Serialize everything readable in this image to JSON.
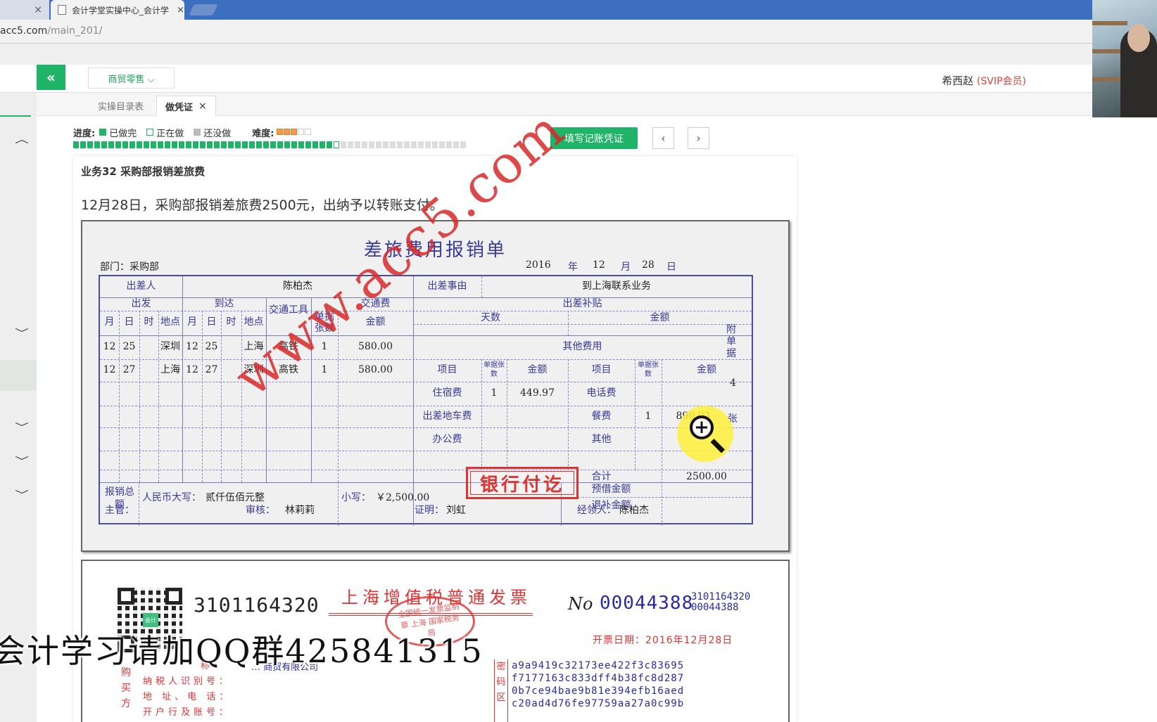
{
  "browser": {
    "tab_left_close": "×",
    "tab_title": "会计学堂实操中心_会计学",
    "tab_close": "×",
    "url_main": "acc5.com",
    "url_path": "/main_201/"
  },
  "header": {
    "collapse_icon": "«",
    "dept_select": "商贸零售 ⌵",
    "user_name": "希西赵",
    "user_level": "(SVIP会员)"
  },
  "tabs": [
    {
      "label": "实操目录表"
    },
    {
      "label": "做凭证",
      "close": "×"
    }
  ],
  "progress": {
    "label": "进度:",
    "done_label": "已做完",
    "doing_label": "正在做",
    "todo_label": "还没做",
    "difficulty_label": "难度:",
    "difficulty_stars": 3,
    "difficulty_max": 5,
    "total_items": 56,
    "completed_items": 37,
    "current_item": 38
  },
  "actions": {
    "fill_voucher": "填写记账凭证",
    "prev": "‹",
    "next": "›"
  },
  "task": {
    "title": "业务32 采购部报销差旅费",
    "description": "12月28日，采购部报销差旅费2500元，出纳予以转账支付。"
  },
  "form": {
    "title": "差旅费用报销单",
    "department": "部门：采购部",
    "year": "2016",
    "year_unit": "年",
    "month": "12",
    "month_unit": "月",
    "day": "28",
    "day_unit": "日",
    "traveler_label": "出差人",
    "traveler": "陈柏杰",
    "reason_label": "出差事由",
    "reason": "到上海联系业务",
    "depart_label": "出发",
    "arrive_label": "到达",
    "transport_tool_label": "交通工具",
    "receipts_label": "单据张数",
    "transport_fee_label": "交通费",
    "allowance_label": "出差补贴",
    "days_label": "天数",
    "amount_label": "金额",
    "month_h": "月",
    "day_h": "日",
    "hour_h": "时",
    "place_h": "地点",
    "other_fees_label": "其他费用",
    "item_label": "项目",
    "trips": [
      {
        "m1": "12",
        "d1": "25",
        "p1": "深圳",
        "m2": "12",
        "d2": "25",
        "p2": "上海",
        "tool": "高铁",
        "n": "1",
        "amt": "580.00"
      },
      {
        "m1": "12",
        "d1": "27",
        "p1": "上海",
        "m2": "12",
        "d2": "27",
        "p2": "深圳",
        "tool": "高铁",
        "n": "1",
        "amt": "580.00"
      }
    ],
    "other_left": [
      {
        "item": "住宿费",
        "n": "1",
        "amt": "449.97"
      },
      {
        "item": "出差地车费",
        "n": "",
        "amt": ""
      },
      {
        "item": "办公费",
        "n": "",
        "amt": ""
      }
    ],
    "other_right": [
      {
        "item": "电话费",
        "n": "",
        "amt": ""
      },
      {
        "item": "餐费",
        "n": "1",
        "amt": "890.03"
      },
      {
        "item": "其他",
        "n": "",
        "amt": ""
      }
    ],
    "total_label": "合计",
    "total": "2500.00",
    "sum_label": "报销总额",
    "rmb_upper_label": "人民币大写：",
    "rmb_upper": "贰仟伍佰元整",
    "small_label": "小写：",
    "small": "￥2,500.00",
    "advance_label": "预借金额",
    "refund_label": "退补金额",
    "attach_label": "附单据",
    "attach_count": "4",
    "attach_unit": "张",
    "supervisor_label": "主管：",
    "reviewer_label": "审核：",
    "reviewer": "林莉莉",
    "witness_label": "证明：",
    "witness": "刘虹",
    "handler_label": "经领人：",
    "handler": "陈柏杰",
    "stamp": "银行付讫",
    "watermark": "www.acc5.com"
  },
  "invoice": {
    "code": "3101164320",
    "title": "上海增值税普通发票",
    "seal_text": "全国统一发票监制章 上海 国家税务局",
    "no_label": "No",
    "number": "00044388",
    "code_small": "3101164320",
    "number_small": "00044388",
    "date": "开票日期：2016年12月28日",
    "buyer_name_label": "称：",
    "taxid_label": "纳税人识别号：",
    "addr_label": "地  址、电  话：",
    "bank_label": "开户行及账号：",
    "buyer_side": "购买方",
    "buyer_name": "… 商贸有限公司",
    "cipher_side": "密码区",
    "cipher": [
      "a9a9419c32173ee422f3c83695",
      "f7177163c833dff4b38fc8d287",
      "0b7ce94bae9b81e394efb16aed",
      "c20ad4d76fe97759aa27a0c99b"
    ],
    "qr_logo": "会计"
  },
  "overlay": {
    "banner": "会计学习请加QQ群425841315"
  },
  "colors": {
    "accent": "#20b468",
    "form_ink": "#3a3a9a",
    "stamp_red": "#dd3333",
    "vip_red": "#e0423a"
  }
}
